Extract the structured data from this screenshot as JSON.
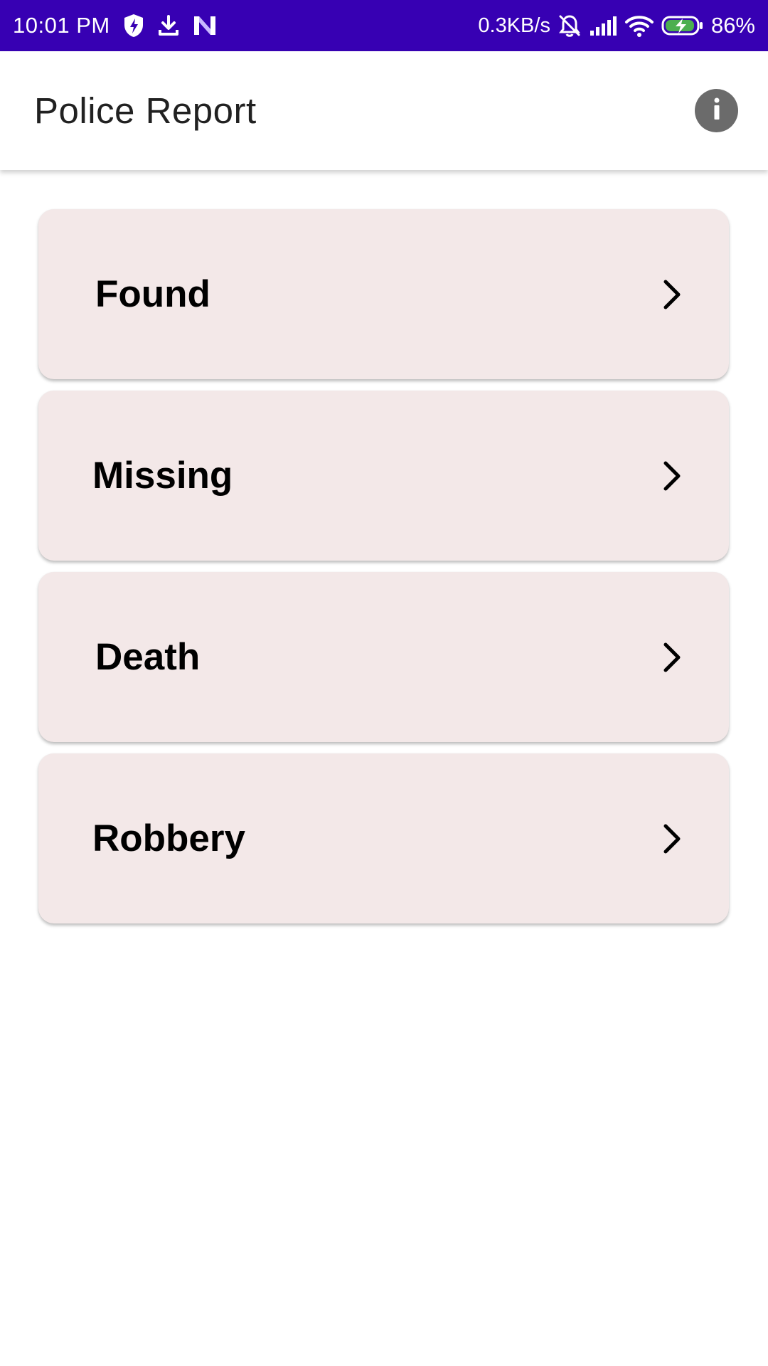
{
  "status_bar": {
    "time": "10:01 PM",
    "network_rate": "0.3KB/s",
    "battery_percent": "86%",
    "icons": [
      "shield-bolt-icon",
      "download-icon",
      "n-app-icon",
      "mute-bell-icon",
      "signal-icon",
      "wifi-icon",
      "battery-charging-icon"
    ],
    "background_color": "#3700b3"
  },
  "app_bar": {
    "title": "Police Report",
    "info_icon": "info-icon"
  },
  "reports": [
    {
      "label": "Found"
    },
    {
      "label": "Missing"
    },
    {
      "label": "Death"
    },
    {
      "label": "Robbery"
    }
  ],
  "colors": {
    "card_background": "#f3e8e8",
    "info_button": "#6b6b6b"
  }
}
